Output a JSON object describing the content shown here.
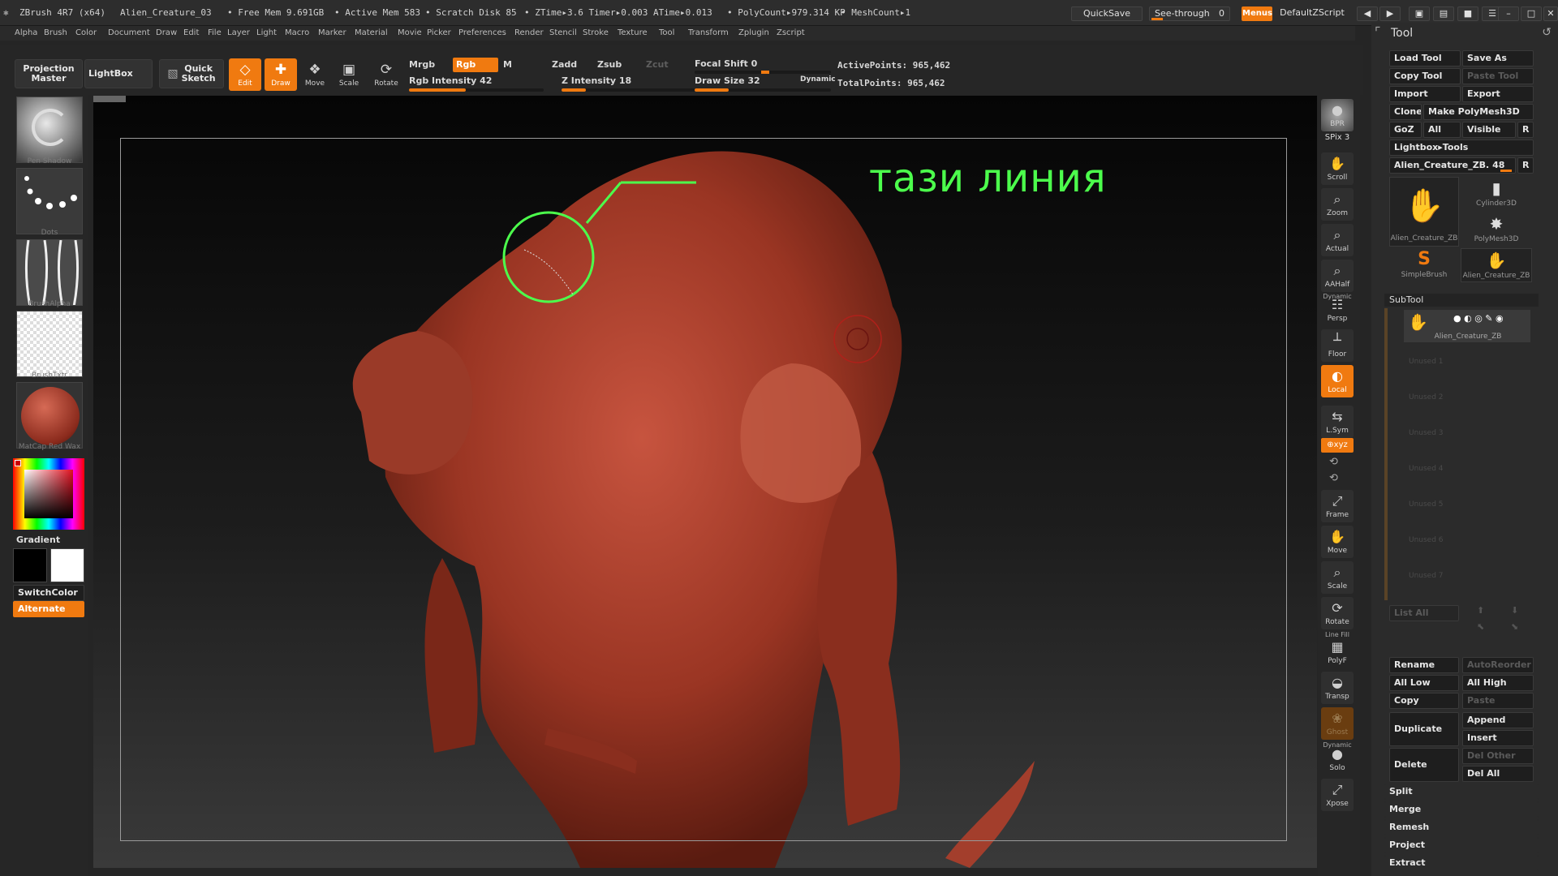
{
  "titlebar": {
    "app": "ZBrush 4R7 (x64)",
    "doc": "Alien_Creature_03",
    "free_mem": "• Free Mem 9.691GB",
    "active_mem": "• Active Mem 583",
    "scratch": "• Scratch Disk 85",
    "ztime": "• ZTime▸3.6 Timer▸0.003 ATime▸0.013",
    "polycount": "• PolyCount▸979.314 KP",
    "meshcount": "• MeshCount▸1",
    "quicksave": "QuickSave",
    "seethrough": "See-through",
    "seethrough_value": "0",
    "menus": "Menus",
    "script": "DefaultZScript"
  },
  "menubar": [
    "Alpha",
    "Brush",
    "Color",
    "Document",
    "Draw",
    "Edit",
    "File",
    "Layer",
    "Light",
    "Macro",
    "Marker",
    "Material",
    "Movie",
    "Picker",
    "Preferences",
    "Render",
    "Stencil",
    "Stroke",
    "Texture",
    "Tool",
    "Transform",
    "Zplugin",
    "Zscript"
  ],
  "shelf": {
    "projection_master_1": "Projection",
    "projection_master_2": "Master",
    "lightbox": "LightBox",
    "quick_sketch_1": "Quick",
    "quick_sketch_2": "Sketch",
    "edit": "Edit",
    "draw": "Draw",
    "move": "Move",
    "scale": "Scale",
    "rotate": "Rotate",
    "mrgb": "Mrgb",
    "rgb": "Rgb",
    "m": "M",
    "zadd": "Zadd",
    "zsub": "Zsub",
    "zcut": "Zcut",
    "rgb_intensity": "Rgb Intensity 42",
    "z_intensity": "Z Intensity 18",
    "focal_shift": "Focal Shift 0",
    "draw_size": "Draw Size 32",
    "dynamic": "Dynamic",
    "active_points": "ActivePoints: 965,462",
    "total_points": "TotalPoints: 965,462",
    "rgb_intensity_value": 42,
    "z_intensity_value": 18,
    "draw_size_value": 32
  },
  "leftcol": {
    "brush": "Pen Shadow",
    "stroke": "Dots",
    "alpha": "BrushAlpha",
    "texture": "BrushTxtr",
    "material": "MatCap Red Wax",
    "gradient": "Gradient",
    "switchcolor": "SwitchColor",
    "alternate": "Alternate"
  },
  "annotation": {
    "text": "тази линия",
    "color": "#4cff4c"
  },
  "righttools": {
    "bpr": "BPR",
    "spix": "SPix 3",
    "scroll": "Scroll",
    "zoom": "Zoom",
    "actual": "Actual",
    "aahalf": "AAHalf",
    "dynamic": "Dynamic",
    "persp": "Persp",
    "floor": "Floor",
    "local": "Local",
    "lsym": "L.Sym",
    "xyz": "⊕xyz",
    "frame": "Frame",
    "move": "Move",
    "scale": "Scale",
    "rotate": "Rotate",
    "linefill": "Line Fill",
    "polyf": "PolyF",
    "transp": "Transp",
    "ghost": "Ghost",
    "dynamic2": "Dynamic",
    "solo": "Solo",
    "xpose": "Xpose"
  },
  "toolpanel": {
    "title": "Tool",
    "load_tool": "Load Tool",
    "save_as": "Save As",
    "copy_tool": "Copy Tool",
    "paste_tool": "Paste Tool",
    "import": "Import",
    "export": "Export",
    "clone": "Clone",
    "make_polymesh": "Make PolyMesh3D",
    "goz": "GoZ",
    "all": "All",
    "visible": "Visible",
    "r": "R",
    "lightbox_tools": "Lightbox▸Tools",
    "current_tool": "Alien_Creature_ZB. 48",
    "tools": [
      {
        "label": "Alien_Creature_ZB",
        "icon": "creature-icon"
      },
      {
        "label": "Cylinder3D",
        "icon": "cylinder-icon"
      },
      {
        "label": "PolyMesh3D",
        "icon": "star-icon"
      },
      {
        "label": "SimpleBrush",
        "icon": "simplebrush-icon"
      },
      {
        "label": "Alien_Creature_ZB",
        "icon": "creature-icon"
      }
    ],
    "subtool_header": "SubTool",
    "subtool_active": "Alien_Creature_ZB",
    "unused": [
      "Unused 1",
      "Unused 2",
      "Unused 3",
      "Unused 4",
      "Unused 5",
      "Unused 6",
      "Unused 7"
    ],
    "list_all": "List All",
    "rename": "Rename",
    "autoreorder": "AutoReorder",
    "all_low": "All Low",
    "all_high": "All High",
    "copy": "Copy",
    "paste": "Paste",
    "append": "Append",
    "duplicate": "Duplicate",
    "insert": "Insert",
    "del_other": "Del Other",
    "delete": "Delete",
    "del_all": "Del All",
    "split": "Split",
    "merge": "Merge",
    "remesh": "Remesh",
    "project": "Project",
    "extract": "Extract"
  },
  "colors": {
    "accent": "#f07a10",
    "sculpt": "#a8402f",
    "annotation": "#4cff4c"
  }
}
